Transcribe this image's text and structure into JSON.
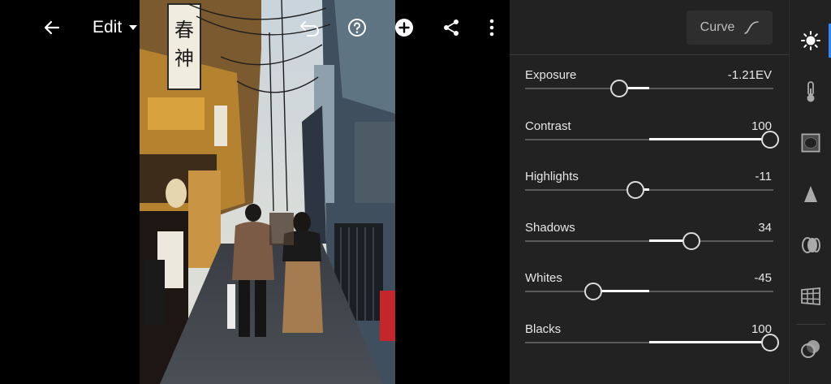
{
  "toolbar": {
    "edit_label": "Edit",
    "icons": [
      "back-arrow-icon",
      "caret-down-icon",
      "undo-icon",
      "help-icon",
      "add-icon",
      "share-icon",
      "more-vertical-icon"
    ]
  },
  "photo": {
    "sign_lantern_chars": "春神"
  },
  "panel": {
    "curve_label": "Curve",
    "sliders": [
      {
        "label": "Exposure",
        "value": "-1.21EV",
        "position": 0.38
      },
      {
        "label": "Contrast",
        "value": "100",
        "position": 1.0
      },
      {
        "label": "Highlights",
        "value": "-11",
        "position": 0.445
      },
      {
        "label": "Shadows",
        "value": "34",
        "position": 0.67
      },
      {
        "label": "Whites",
        "value": "-45",
        "position": 0.275
      },
      {
        "label": "Blacks",
        "value": "100",
        "position": 1.0
      }
    ]
  },
  "rail": {
    "active": "light",
    "icons": [
      "light-icon",
      "color-temperature-icon",
      "effects-vignette-icon",
      "detail-sharpen-icon",
      "optics-icon",
      "geometry-icon",
      "mask-icon"
    ]
  },
  "colors": {
    "accent": "#2f86f5",
    "panel_bg": "#222222",
    "track": "#5a5a5a"
  }
}
